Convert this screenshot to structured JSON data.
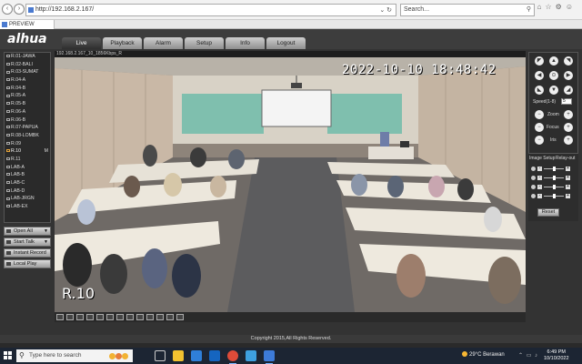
{
  "browser": {
    "url": "http://192.168.2.167/",
    "search_placeholder": "Search...",
    "tab_title": "PREVIEW"
  },
  "app": {
    "logo": "alhua",
    "tabs": [
      {
        "label": "Live"
      },
      {
        "label": "Playback"
      },
      {
        "label": "Alarm"
      },
      {
        "label": "Setup"
      },
      {
        "label": "Info"
      },
      {
        "label": "Logout"
      }
    ]
  },
  "cameras": [
    {
      "label": "R.01-JAWA"
    },
    {
      "label": "R.02-BALI"
    },
    {
      "label": "R.03-SUMAT"
    },
    {
      "label": "R.04-A"
    },
    {
      "label": "R.04-B"
    },
    {
      "label": "R.05-A"
    },
    {
      "label": "R.05-B"
    },
    {
      "label": "R.06-A"
    },
    {
      "label": "R.06-B"
    },
    {
      "label": "R.07-PAPUA"
    },
    {
      "label": "R.08-LOMBK"
    },
    {
      "label": "R.09"
    },
    {
      "label": "R.10",
      "mark": "M"
    },
    {
      "label": "R.11"
    },
    {
      "label": "LAB-A"
    },
    {
      "label": "LAB-B"
    },
    {
      "label": "LAB-C"
    },
    {
      "label": "LAB-D"
    },
    {
      "label": "LAB-JRGN"
    },
    {
      "label": "LAB-EX"
    }
  ],
  "side_buttons": {
    "open_all": "Open All",
    "start_talk": "Start Talk",
    "instant_record": "Instant Record",
    "local_play": "Local Play"
  },
  "video": {
    "stream_info": "192.168.2.167_10_1856Kbps_R",
    "timestamp": "2022-10-10 18:48:42",
    "room_label": "R.10"
  },
  "ptz": {
    "speed_label": "Speed(1-8)",
    "speed_value": "5",
    "zoom_label": "Zoom",
    "focus_label": "Focus",
    "iris_label": "Iris"
  },
  "image_setup": {
    "tab1": "Image Setup",
    "tab2": "Relay-out",
    "reset_label": "Reset"
  },
  "footer": {
    "copyright": "Copyright 2015,All Rights Reserved."
  },
  "taskbar": {
    "search_placeholder": "Type here to search",
    "weather": "29°C  Berawan",
    "time": "6:49 PM",
    "date": "10/10/2022"
  }
}
